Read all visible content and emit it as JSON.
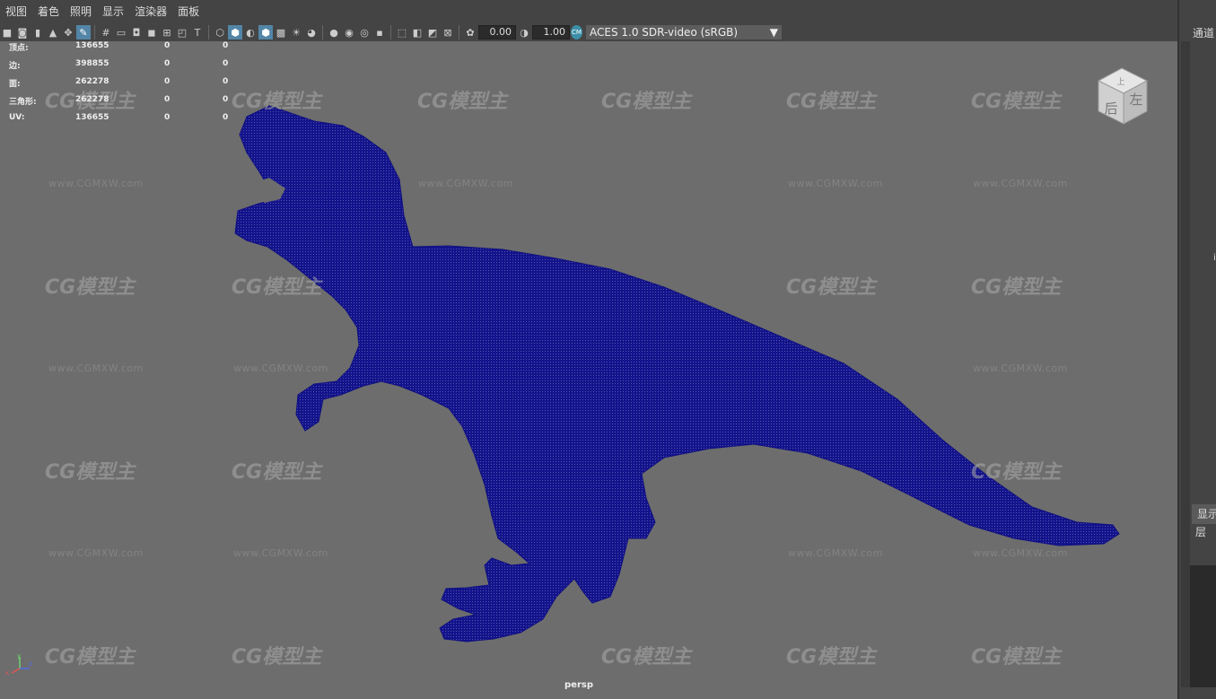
{
  "menu": [
    "视图",
    "着色",
    "照明",
    "显示",
    "渲染器",
    "面板"
  ],
  "toolbar": {
    "exposure_value": "0.00",
    "gamma_value": "1.00",
    "colorspace_icon": "color-management-icon",
    "colorspace": "ACES 1.0 SDR-video (sRGB)"
  },
  "stats": [
    {
      "label": "顶点:",
      "v1": "136655",
      "v2": "0",
      "v3": "0"
    },
    {
      "label": "边:",
      "v1": "398855",
      "v2": "0",
      "v3": "0"
    },
    {
      "label": "面:",
      "v1": "262278",
      "v2": "0",
      "v3": "0"
    },
    {
      "label": "三角形:",
      "v1": "262278",
      "v2": "0",
      "v3": "0"
    },
    {
      "label": "UV:",
      "v1": "136655",
      "v2": "0",
      "v3": "0"
    }
  ],
  "viewport": {
    "camera": "persp",
    "mesh_color": "#13138c",
    "background_color": "#6d6d6d"
  },
  "viewcube": {
    "top": "上",
    "front": "后",
    "side": "左"
  },
  "watermark": {
    "logo": "CG模型主",
    "url": "www.CGMXW.com"
  },
  "axis": {
    "x": "x",
    "y": "y",
    "z": "z"
  },
  "right_panel": {
    "channels": "通道",
    "mark": "i",
    "display": "显示",
    "layer": "层"
  }
}
